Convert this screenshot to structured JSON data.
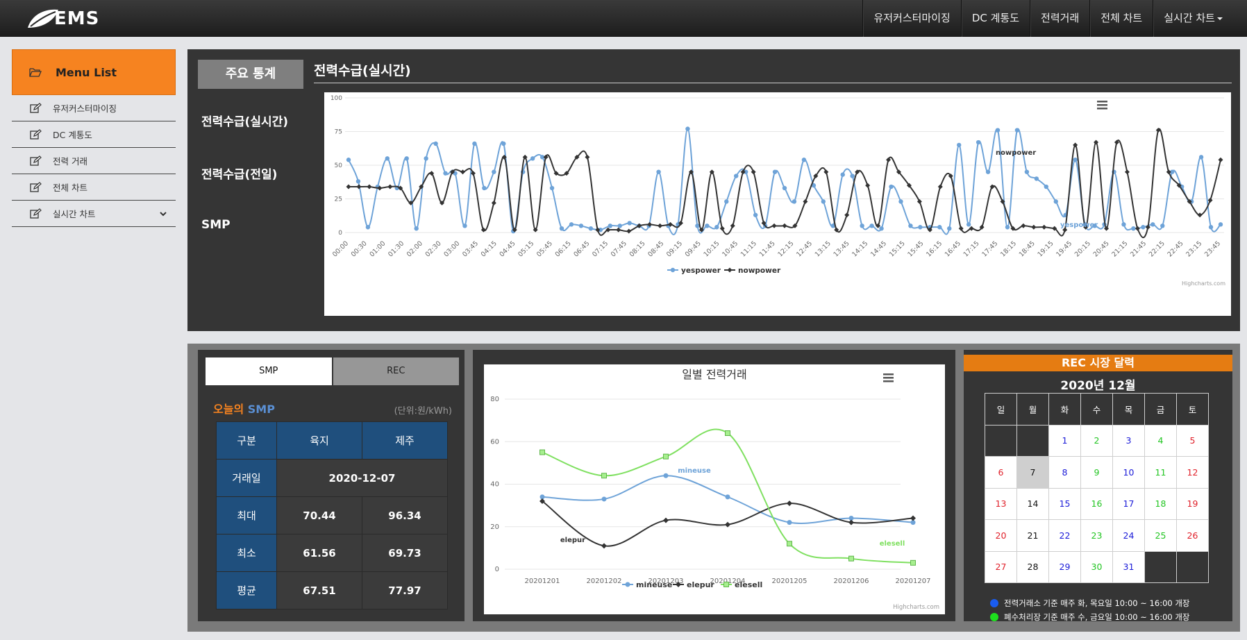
{
  "app": {
    "logo_text": "EMS"
  },
  "nav": {
    "items": [
      "유저커스터마이징",
      "DC 계통도",
      "전력거래",
      "전체 차트",
      "실시간 차트"
    ]
  },
  "sidebar": {
    "header": "Menu List",
    "items": [
      "유저커스터마이징",
      "DC 계통도",
      "전력 거래",
      "전체 차트",
      "실시간 차트"
    ]
  },
  "main": {
    "tab_label": "주요 통계",
    "title": "전력수급(실시간)",
    "links": [
      "전력수급(실시간)",
      "전력수급(전일)",
      "SMP"
    ]
  },
  "smp_panel": {
    "tabs": [
      "SMP",
      "REC"
    ],
    "title_prefix": "오늘의",
    "title_main": "SMP",
    "unit": "(단위:원/kWh)",
    "headers": [
      "구분",
      "육지",
      "제주"
    ],
    "rows": [
      {
        "label": "거래일",
        "value": "2020-12-07"
      },
      {
        "label": "최대",
        "land": "70.44",
        "jeju": "96.34"
      },
      {
        "label": "최소",
        "land": "61.56",
        "jeju": "69.73"
      },
      {
        "label": "평균",
        "land": "67.51",
        "jeju": "77.97"
      }
    ]
  },
  "calendar": {
    "title": "REC 시장 달력",
    "month": "2020년 12월",
    "weekdays": [
      "일",
      "월",
      "화",
      "수",
      "목",
      "금",
      "토"
    ],
    "weeks": [
      [
        "",
        "",
        "1",
        "2",
        "3",
        "4",
        "5"
      ],
      [
        "6",
        "7",
        "8",
        "9",
        "10",
        "11",
        "12"
      ],
      [
        "13",
        "14",
        "15",
        "16",
        "17",
        "18",
        "19"
      ],
      [
        "20",
        "21",
        "22",
        "23",
        "24",
        "25",
        "26"
      ],
      [
        "27",
        "28",
        "29",
        "30",
        "31",
        "",
        ""
      ]
    ],
    "today": "7",
    "legend": [
      {
        "color": "#1a5cf0",
        "text": "전력거래소 기준 매주 화, 목요일 10:00 ~ 16:00 개장"
      },
      {
        "color": "#1ee01e",
        "text": "폐수처리장 기준 매주 수, 금요일 10:00 ~ 16:00 개장"
      }
    ]
  },
  "chart_data": [
    {
      "type": "line",
      "yticks": [
        0,
        25,
        50,
        75,
        100
      ],
      "ylim": [
        0,
        100
      ],
      "x_tick_labels": [
        "00:00",
        "00:30",
        "01:00",
        "01:30",
        "02:00",
        "02:30",
        "03:00",
        "03:45",
        "04:15",
        "04:45",
        "05:15",
        "05:45",
        "06:15",
        "06:45",
        "07:15",
        "07:45",
        "08:15",
        "08:45",
        "09:15",
        "09:45",
        "10:15",
        "10:45",
        "11:15",
        "11:45",
        "12:15",
        "12:45",
        "13:15",
        "13:45",
        "14:15",
        "14:45",
        "15:15",
        "15:45",
        "16:15",
        "16:45",
        "17:15",
        "17:45",
        "18:15",
        "18:45",
        "19:15",
        "19:45",
        "20:15",
        "20:45",
        "21:15",
        "21:45",
        "22:15",
        "22:45",
        "23:15",
        "23:45"
      ],
      "series": [
        {
          "name": "yespower",
          "color": "#6ea3d8",
          "values": [
            54,
            38,
            4,
            34,
            55,
            33,
            55,
            3,
            55,
            66,
            44,
            44,
            5,
            66,
            33,
            45,
            66,
            1,
            45,
            55,
            56,
            33,
            3,
            6,
            5,
            3,
            2,
            5,
            5,
            7,
            5,
            5,
            45,
            5,
            6,
            77,
            5,
            5,
            4,
            23,
            42,
            45,
            13,
            5,
            45,
            33,
            23,
            54,
            35,
            23,
            5,
            43,
            42,
            5,
            5,
            3,
            34,
            23,
            5,
            4,
            4,
            4,
            3,
            65,
            6,
            67,
            45,
            76,
            4,
            76,
            45,
            40,
            34,
            23,
            13,
            54,
            6,
            5,
            6,
            45,
            6,
            3,
            4,
            6,
            5,
            45,
            34,
            23,
            56,
            4,
            6
          ]
        },
        {
          "name": "nowpower",
          "color": "#333333",
          "values": [
            34,
            34,
            34,
            33,
            34,
            33,
            22,
            34,
            44,
            22,
            45,
            45,
            44,
            2,
            22,
            56,
            2,
            56,
            2,
            56,
            44,
            44,
            56,
            56,
            2,
            2,
            2,
            1,
            5,
            6,
            5,
            6,
            7,
            45,
            2,
            45,
            3,
            5,
            45,
            45,
            7,
            5,
            5,
            5,
            23,
            42,
            45,
            2,
            13,
            45,
            35,
            5,
            54,
            45,
            35,
            23,
            2,
            34,
            42,
            3,
            3,
            4,
            34,
            23,
            3,
            5,
            4,
            4,
            3,
            2,
            65,
            4,
            67,
            3,
            67,
            45,
            3,
            4,
            76,
            45,
            35,
            23,
            13,
            24,
            54
          ]
        }
      ],
      "labels": {
        "nowpower": "nowpower",
        "yespower": "yespower"
      },
      "credit": "Highcharts.com"
    },
    {
      "type": "line",
      "title": "일별 전력거래",
      "categories": [
        "20201201",
        "20201202",
        "20201203",
        "20201204",
        "20201205",
        "20201206",
        "20201207"
      ],
      "yticks": [
        0,
        20,
        40,
        60,
        80
      ],
      "ylim": [
        0,
        80
      ],
      "series": [
        {
          "name": "mineuse",
          "color": "#6ea3d8",
          "values": [
            34,
            33,
            44,
            34,
            22,
            24,
            22
          ]
        },
        {
          "name": "elepur",
          "color": "#333333",
          "values": [
            32,
            11,
            23,
            21,
            31,
            22,
            24
          ]
        },
        {
          "name": "elesell",
          "color": "#7fe060",
          "values": [
            55,
            44,
            53,
            64,
            12,
            5,
            3
          ]
        }
      ],
      "credit": "Highcharts.com"
    }
  ]
}
